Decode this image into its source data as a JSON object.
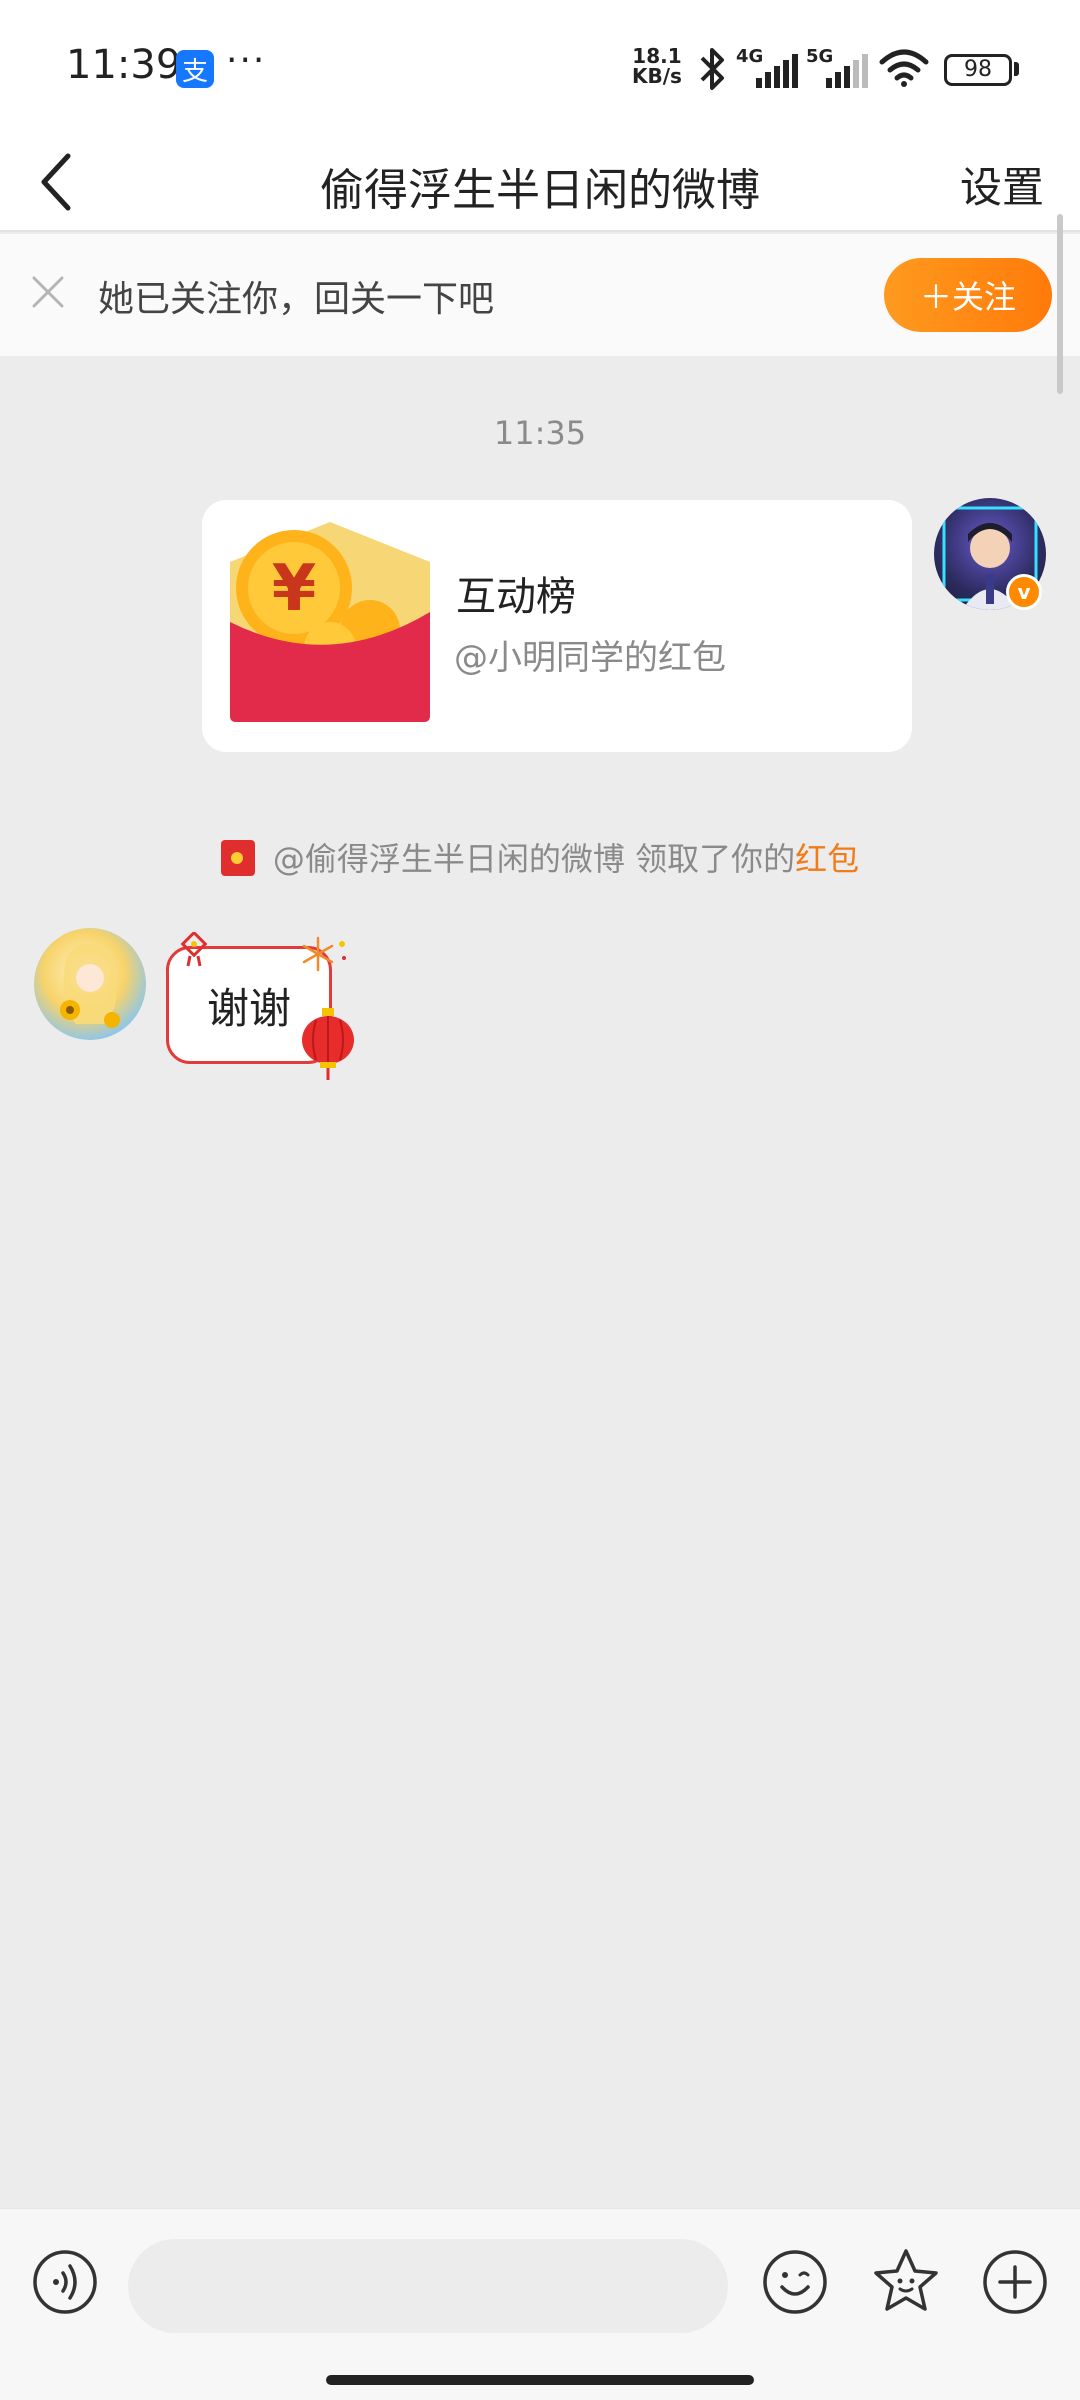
{
  "status_bar": {
    "time": "11:39",
    "alipay_glyph": "支",
    "more": "···",
    "net_speed_value": "18.1",
    "net_speed_unit": "KB/s",
    "sig1_label": "4G",
    "sig2_label": "5G",
    "battery": "98"
  },
  "header": {
    "title": "偷得浮生半日闲的微博",
    "settings_label": "设置"
  },
  "follow_banner": {
    "text": "她已关注你，回关一下吧",
    "button_label": "＋关注"
  },
  "chat": {
    "timestamp": "11:35",
    "card": {
      "title": "互动榜",
      "subtitle": "@小明同学的红包"
    },
    "notice": {
      "prefix": "@偷得浮生半日闲的微博 领取了你的",
      "link": "红包"
    },
    "message": "谢谢"
  },
  "colors": {
    "accent": "#ff8a00",
    "link": "#f07b17",
    "bubble_border": "#e23b3b"
  }
}
